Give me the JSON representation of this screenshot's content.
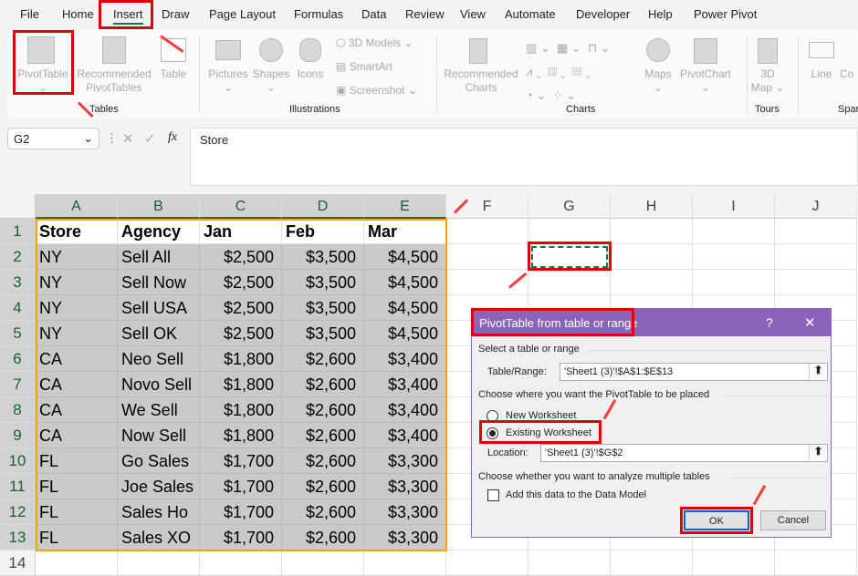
{
  "menu": [
    "File",
    "Home",
    "Insert",
    "Draw",
    "Page Layout",
    "Formulas",
    "Data",
    "Review",
    "View",
    "Automate",
    "Developer",
    "Help",
    "Power Pivot"
  ],
  "ribbon": {
    "tables": {
      "pivot_table": "PivotTable",
      "recommended": [
        "Recommended",
        "PivotTables"
      ],
      "table": "Table",
      "group": "Tables"
    },
    "illustrations": {
      "pictures": "Pictures",
      "shapes": "Shapes",
      "icons": "Icons",
      "models": "3D Models",
      "smartart": "SmartArt",
      "screenshot": "Screenshot",
      "group": "Illustrations"
    },
    "charts": {
      "recommended": [
        "Recommended",
        "Charts"
      ],
      "maps": "Maps",
      "pivotchart": "PivotChart",
      "group": "Charts"
    },
    "tours": {
      "map": [
        "3D",
        "Map"
      ],
      "group": "Tours"
    },
    "sparklines": {
      "line": "Line",
      "column": "Co",
      "group": "Spar"
    }
  },
  "formula_bar": {
    "name_box": "G2",
    "fx": "fx",
    "content": "Store"
  },
  "columns": [
    "A",
    "B",
    "C",
    "D",
    "E",
    "F",
    "G",
    "H",
    "I",
    "J"
  ],
  "rows": [
    "1",
    "2",
    "3",
    "4",
    "5",
    "6",
    "7",
    "8",
    "9",
    "10",
    "11",
    "12",
    "13",
    "14"
  ],
  "table": {
    "headers": [
      "Store",
      "Agency",
      "Jan",
      "Feb",
      "Mar"
    ],
    "data": [
      [
        "NY",
        "Sell All",
        "$2,500",
        "$3,500",
        "$4,500"
      ],
      [
        "NY",
        "Sell Now",
        "$2,500",
        "$3,500",
        "$4,500"
      ],
      [
        "NY",
        "Sell USA",
        "$2,500",
        "$3,500",
        "$4,500"
      ],
      [
        "NY",
        "Sell OK",
        "$2,500",
        "$3,500",
        "$4,500"
      ],
      [
        "CA",
        "Neo Sell",
        "$1,800",
        "$2,600",
        "$3,400"
      ],
      [
        "CA",
        "Novo Sell",
        "$1,800",
        "$2,600",
        "$3,400"
      ],
      [
        "CA",
        "We Sell",
        "$1,800",
        "$2,600",
        "$3,400"
      ],
      [
        "CA",
        "Now Sell",
        "$1,800",
        "$2,600",
        "$3,400"
      ],
      [
        "FL",
        "Go Sales",
        "$1,700",
        "$2,600",
        "$3,300"
      ],
      [
        "FL",
        "Joe Sales",
        "$1,700",
        "$2,600",
        "$3,300"
      ],
      [
        "FL",
        "Sales Ho",
        "$1,700",
        "$2,600",
        "$3,300"
      ],
      [
        "FL",
        "Sales XO",
        "$1,700",
        "$2,600",
        "$3,300"
      ]
    ]
  },
  "dialog": {
    "title": "PivotTable from table or range",
    "help": "?",
    "close": "✕",
    "section1": "Select a table or range",
    "range_label": "Table/Range:",
    "range_value": "'Sheet1 (3)'!$A$1:$E$13",
    "section2": "Choose where you want the PivotTable to be placed",
    "new_ws": "New Worksheet",
    "existing_ws": "Existing Worksheet",
    "selected": "existing",
    "location_label": "Location:",
    "location_value": "'Sheet1 (3)'!$G$2",
    "section3": "Choose whether you want to analyze multiple tables",
    "data_model": "Add this data to the Data Model",
    "data_model_checked": false,
    "ok": "OK",
    "cancel": "Cancel"
  },
  "colors": {
    "accent": "#8b63b9",
    "highlight": "#e00000",
    "excel_green": "#1b7340",
    "selection": "#f0a800"
  }
}
